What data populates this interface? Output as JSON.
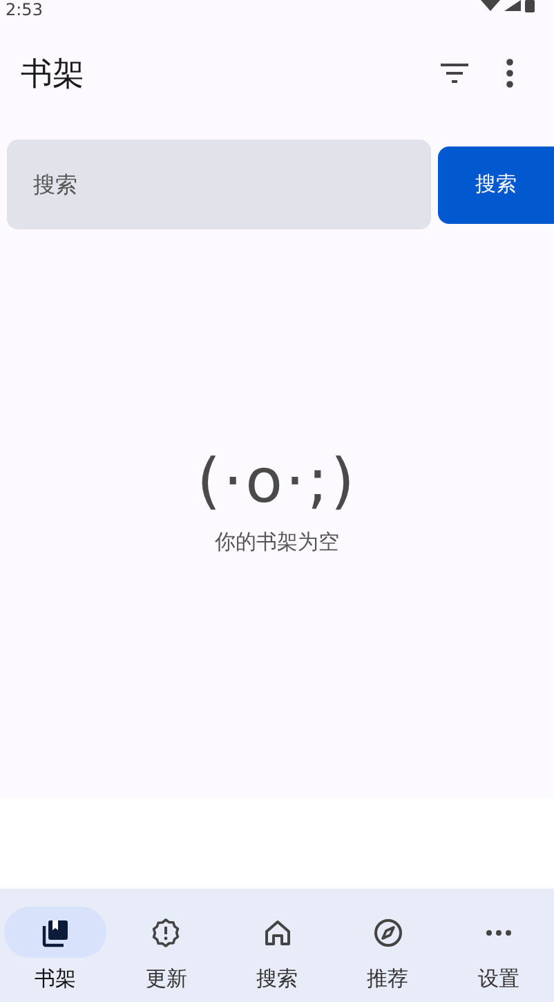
{
  "status_bar": {
    "time": "2:53"
  },
  "app_bar": {
    "title": "书架"
  },
  "search": {
    "placeholder": "搜索",
    "button": "搜索"
  },
  "empty_state": {
    "face": "(·o·;)",
    "message": "你的书架为空"
  },
  "bottom_nav": [
    {
      "label": "书架",
      "kind": "shelf",
      "selected": true
    },
    {
      "label": "更新",
      "kind": "update",
      "selected": false
    },
    {
      "label": "搜索",
      "kind": "home",
      "selected": false
    },
    {
      "label": "推荐",
      "kind": "compass",
      "selected": false
    },
    {
      "label": "设置",
      "kind": "more",
      "selected": false
    }
  ]
}
